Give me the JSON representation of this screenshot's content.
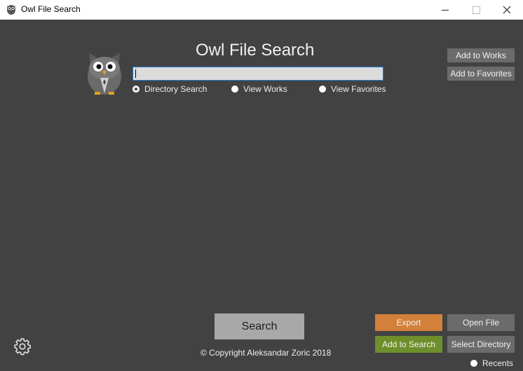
{
  "window": {
    "title": "Owl File Search",
    "controls": {
      "minimize": "minimize",
      "maximize": "maximize",
      "close": "close"
    }
  },
  "main": {
    "heading": "Owl File Search",
    "search_value": "",
    "radios": [
      {
        "label": "Directory Search",
        "checked": true
      },
      {
        "label": "View Works",
        "checked": false
      },
      {
        "label": "View Favorites",
        "checked": false
      }
    ]
  },
  "side_buttons": {
    "add_to_works": "Add to Works",
    "add_to_favorites": "Add to Favorites"
  },
  "bottom": {
    "search": "Search",
    "export": "Export",
    "open_file": "Open File",
    "add_to_search": "Add to Search",
    "select_directory": "Select Directory",
    "copyright": "© Copyright Aleksandar Zoric 2018",
    "recents": "Recents"
  },
  "colors": {
    "background": "#424242",
    "export": "#d3803a",
    "add_to_search": "#6e8f2b",
    "search_button": "#a8a8a8",
    "gray_button": "#6b6b6b",
    "input_focus_border": "#1e7ad6"
  },
  "icons": {
    "app": "owl-icon",
    "logo": "owl-logo",
    "settings": "gear-icon"
  }
}
